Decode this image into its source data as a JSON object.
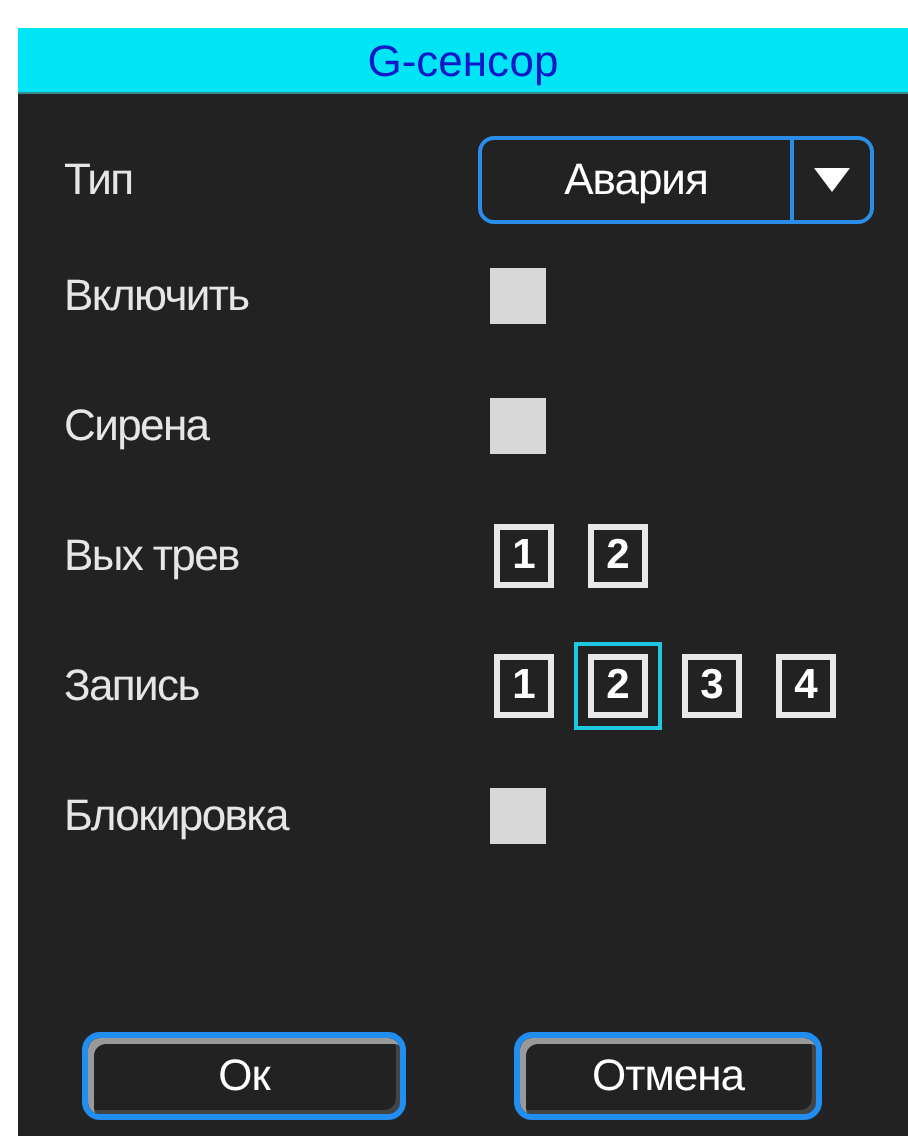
{
  "dialog": {
    "title": "G-сенсор"
  },
  "rows": [
    {
      "kind": "dropdown",
      "label": "Тип",
      "value": "Авария"
    },
    {
      "kind": "checkbox",
      "label": "Включить",
      "checked": false
    },
    {
      "kind": "checkbox",
      "label": "Сирена",
      "checked": false
    },
    {
      "kind": "channels",
      "label": "Вых трев",
      "channels": [
        {
          "label": "1",
          "selected": false
        },
        {
          "label": "2",
          "selected": false
        }
      ]
    },
    {
      "kind": "channels",
      "label": "Запись",
      "channels": [
        {
          "label": "1",
          "selected": false
        },
        {
          "label": "2",
          "selected": true
        },
        {
          "label": "3",
          "selected": false
        },
        {
          "label": "4",
          "selected": false
        }
      ]
    },
    {
      "kind": "checkbox",
      "label": "Блокировка",
      "checked": false
    }
  ],
  "buttons": [
    "Ок",
    "Отмена"
  ]
}
